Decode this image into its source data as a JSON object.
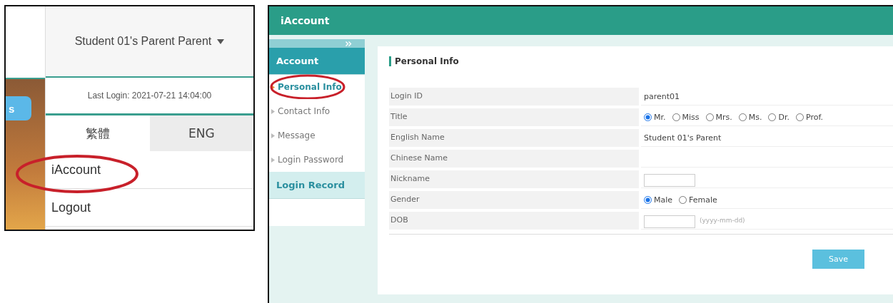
{
  "user_menu": {
    "partial_tab": "s",
    "user_name": "Student 01's Parent Parent",
    "last_login": "Last Login: 2021-07-21 14:04:00",
    "languages": [
      {
        "label": "繁體",
        "selected": false
      },
      {
        "label": "ENG",
        "selected": true
      }
    ],
    "items": [
      {
        "label": "iAccount",
        "circled": true
      },
      {
        "label": "Logout",
        "circled": false
      }
    ]
  },
  "window": {
    "title": "iAccount"
  },
  "sidebar": {
    "sections": [
      {
        "label": "Account",
        "expanded": true,
        "items": [
          {
            "label": "Personal Info",
            "selected": true,
            "circled": true
          },
          {
            "label": "Contact Info",
            "selected": false,
            "circled": false
          },
          {
            "label": "Message",
            "selected": false,
            "circled": false
          },
          {
            "label": "Login Password",
            "selected": false,
            "circled": false
          }
        ]
      },
      {
        "label": "Login Record",
        "expanded": false
      }
    ]
  },
  "form": {
    "title": "Personal Info",
    "fields": [
      {
        "label": "Login ID",
        "kind": "text",
        "value": "parent01"
      },
      {
        "label": "Title",
        "kind": "radio",
        "options": [
          {
            "label": "Mr.",
            "selected": true
          },
          {
            "label": "Miss",
            "selected": false
          },
          {
            "label": "Mrs.",
            "selected": false
          },
          {
            "label": "Ms.",
            "selected": false
          },
          {
            "label": "Dr.",
            "selected": false
          },
          {
            "label": "Prof.",
            "selected": false
          }
        ]
      },
      {
        "label": "English Name",
        "kind": "text",
        "value": "Student 01's Parent"
      },
      {
        "label": "Chinese Name",
        "kind": "text"
      },
      {
        "label": "Nickname",
        "kind": "input"
      },
      {
        "label": "Gender",
        "kind": "radio",
        "options": [
          {
            "label": "Male",
            "selected": true
          },
          {
            "label": "Female",
            "selected": false
          }
        ]
      },
      {
        "label": "DOB",
        "kind": "input",
        "hint": "(yyyy-mm-dd)"
      }
    ],
    "save_button": "Save"
  }
}
